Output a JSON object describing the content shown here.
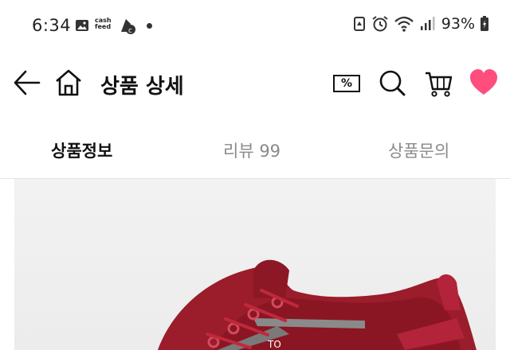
{
  "status_bar": {
    "time": "6:34",
    "cash_app_line1": "cash",
    "cash_app_line2": "feed",
    "battery_percent": "93%",
    "icons": [
      "gallery-icon",
      "cashfeed-icon",
      "bike-icon",
      "recycle-icon",
      "alarm-icon",
      "wifi-icon",
      "signal-icon",
      "battery-icon"
    ]
  },
  "header": {
    "title": "상품 상세",
    "coupon_symbol": "%",
    "icons": [
      "back-arrow-icon",
      "home-icon",
      "coupon-icon",
      "search-icon",
      "cart-icon",
      "heart-icon"
    ],
    "heart_color": "#ff4d7e"
  },
  "tabs": [
    {
      "label": "상품정보",
      "active": true
    },
    {
      "label": "리뷰 99",
      "active": false
    },
    {
      "label": "상품문의",
      "active": false
    }
  ],
  "product": {
    "image_label": "TO",
    "shoe_color": "#9b1c2a"
  }
}
